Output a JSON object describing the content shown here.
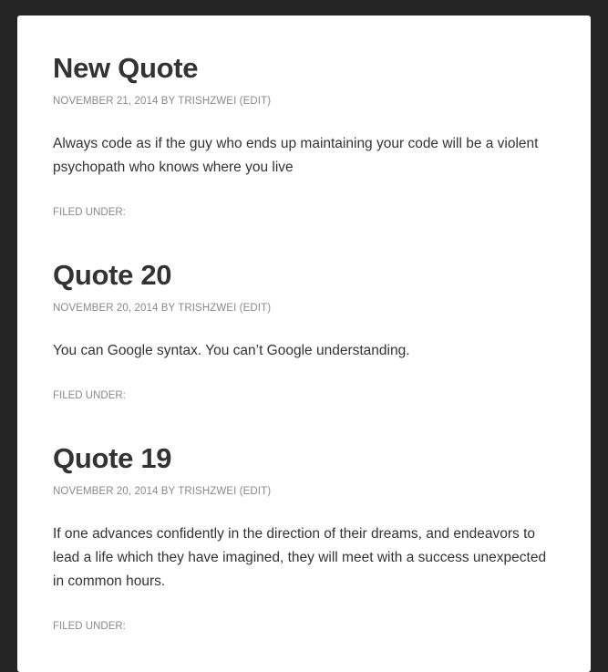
{
  "posts": [
    {
      "title": "New Quote",
      "date": "NOVEMBER 21, 2014",
      "by": "BY",
      "author": "TRISHZWEI",
      "edit": "(EDIT)",
      "content": "Always code as if the guy who ends up maintaining your code will be a violent psychopath who knows where you live",
      "filed_under": "FILED UNDER:"
    },
    {
      "title": "Quote 20",
      "date": "NOVEMBER 20, 2014",
      "by": "BY",
      "author": "TRISHZWEI",
      "edit": "(EDIT)",
      "content": "You can Google syntax. You can’t Google understanding.",
      "filed_under": "FILED UNDER:"
    },
    {
      "title": "Quote 19",
      "date": "NOVEMBER 20, 2014",
      "by": "BY",
      "author": "TRISHZWEI",
      "edit": "(EDIT)",
      "content": "If one advances confidently in the direction of their dreams, and endeavors to lead a life which they have imagined, they will meet with a success unexpected in common hours.",
      "filed_under": "FILED UNDER:"
    }
  ],
  "colors": {
    "page_background": "#242424",
    "card_background": "#ffffff",
    "title_text": "#333333",
    "meta_text": "#8a8a8a"
  }
}
